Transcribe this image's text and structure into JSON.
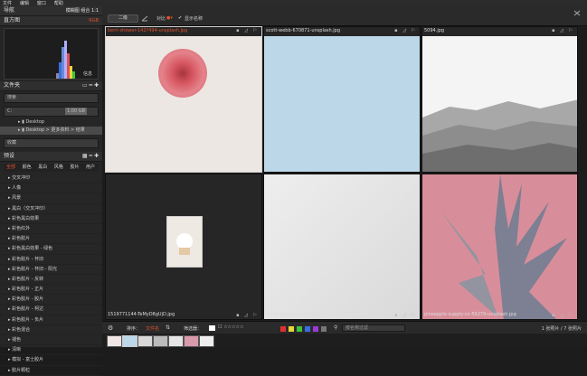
{
  "menubar": {
    "items": [
      "文件",
      "编辑",
      "窗口",
      "帮助"
    ]
  },
  "left": {
    "nav": {
      "title": "导航",
      "tabs": [
        "模糊图",
        "组合",
        "1:1"
      ]
    },
    "histogram": {
      "title": "直方图",
      "mode": "RGB",
      "info": "信息"
    },
    "folders": {
      "title": "文件夹",
      "search_placeholder": "搜索",
      "drive": "C:",
      "drive_info": "1.00 GB",
      "rows": [
        "Desktop",
        "Desktop > 更多资料 > 结果"
      ],
      "favorites": "收藏"
    },
    "presets": {
      "title": "预设",
      "tabs": [
        "全部",
        "颜色",
        "黑白",
        "风格",
        "胶片",
        "用户"
      ],
      "items": [
        "交叉冲印",
        "人像",
        "风景",
        "黑白（交叉冲印）",
        "彩色黑白效果",
        "彩色红外",
        "彩色胶片",
        "彩色黑白效果 - 绿色",
        "彩色胶片 - 怀旧",
        "彩色胶片 - 怀旧 - 阳光",
        "彩色胶片 - 反转",
        "彩色胶片 - 正片",
        "彩色胶片 - 胶片",
        "彩色胶片 - 柯达",
        "彩色胶片 - 负片",
        "彩色混合",
        "褪色",
        "清晰",
        "模拟 - 富士胶片",
        "胶片颗粒"
      ]
    }
  },
  "topbar": {
    "btn1": "二级",
    "label": "对比",
    "checkbox_label": "显示名称"
  },
  "grid": {
    "cells": [
      {
        "label": "berri-shower-142?494-unsplash.jpg",
        "highlight": true
      },
      {
        "label": "scott-webb-670871-unsplash.jpg",
        "highlight": false
      },
      {
        "label": "5094.jpg",
        "highlight": false
      },
      {
        "label": "1519771144-TeMyD8gUjD.jpg",
        "highlight": false
      },
      {
        "label": "annie-austy-ke-1426774-unsplash.jpg",
        "highlight": false
      },
      {
        "label": "pineapple-supply-co-56279-unsplash.jpg",
        "highlight": false
      }
    ]
  },
  "bottombar": {
    "sort_label": "排序：",
    "sort_value": "文件名",
    "filter_label": "筛选器：",
    "search_placeholder": "按名称过滤",
    "status": "1 张照片 / 7 张照片"
  },
  "colors": {
    "accent": "#e0522b",
    "selected_border": "#cfcfcf",
    "labels": [
      "#e03030",
      "#e8d63a",
      "#3bc43b",
      "#3a6ee0",
      "#9a3ad6",
      "#777777"
    ]
  }
}
